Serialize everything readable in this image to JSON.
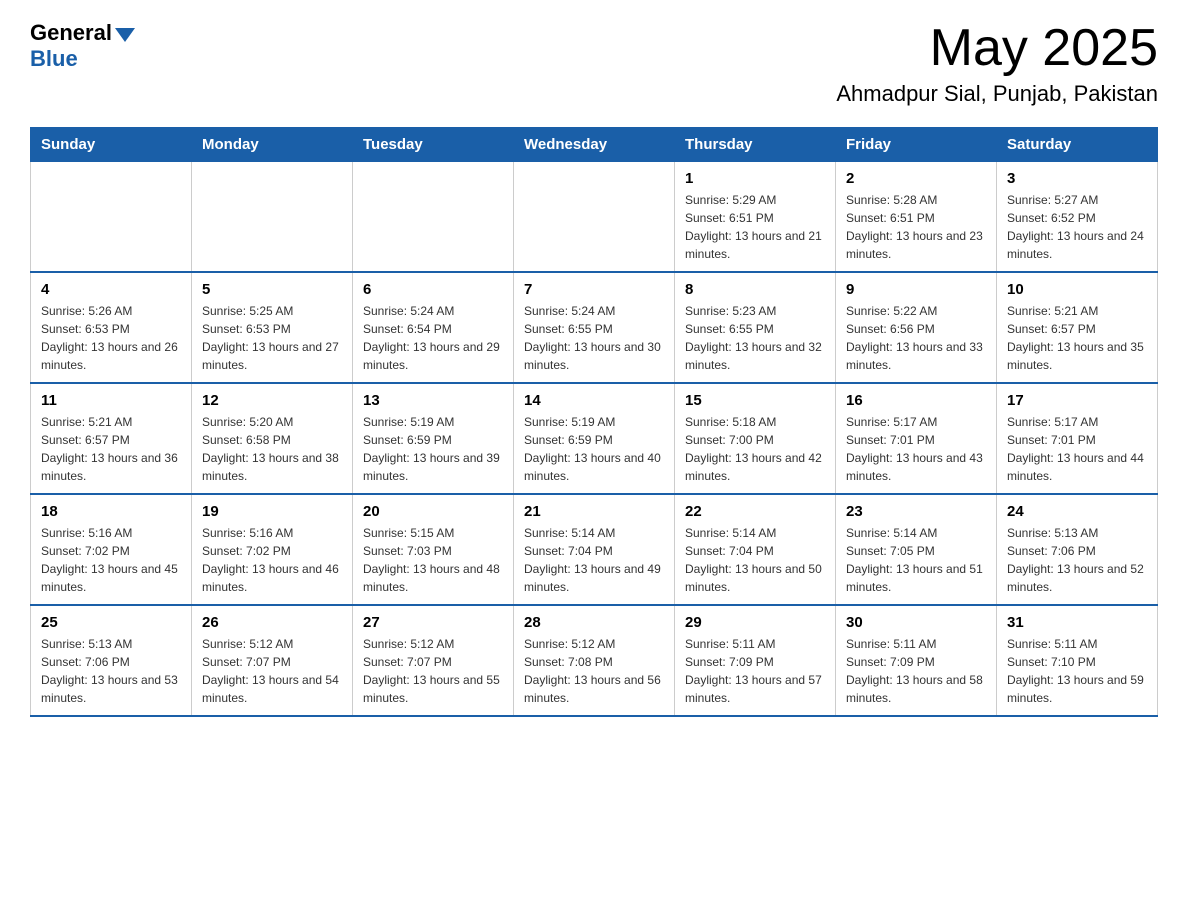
{
  "logo": {
    "general_text": "General",
    "blue_text": "Blue"
  },
  "title": {
    "month_year": "May 2025",
    "location": "Ahmadpur Sial, Punjab, Pakistan"
  },
  "weekdays": [
    "Sunday",
    "Monday",
    "Tuesday",
    "Wednesday",
    "Thursday",
    "Friday",
    "Saturday"
  ],
  "weeks": [
    [
      {
        "day": "",
        "info": ""
      },
      {
        "day": "",
        "info": ""
      },
      {
        "day": "",
        "info": ""
      },
      {
        "day": "",
        "info": ""
      },
      {
        "day": "1",
        "info": "Sunrise: 5:29 AM\nSunset: 6:51 PM\nDaylight: 13 hours and 21 minutes."
      },
      {
        "day": "2",
        "info": "Sunrise: 5:28 AM\nSunset: 6:51 PM\nDaylight: 13 hours and 23 minutes."
      },
      {
        "day": "3",
        "info": "Sunrise: 5:27 AM\nSunset: 6:52 PM\nDaylight: 13 hours and 24 minutes."
      }
    ],
    [
      {
        "day": "4",
        "info": "Sunrise: 5:26 AM\nSunset: 6:53 PM\nDaylight: 13 hours and 26 minutes."
      },
      {
        "day": "5",
        "info": "Sunrise: 5:25 AM\nSunset: 6:53 PM\nDaylight: 13 hours and 27 minutes."
      },
      {
        "day": "6",
        "info": "Sunrise: 5:24 AM\nSunset: 6:54 PM\nDaylight: 13 hours and 29 minutes."
      },
      {
        "day": "7",
        "info": "Sunrise: 5:24 AM\nSunset: 6:55 PM\nDaylight: 13 hours and 30 minutes."
      },
      {
        "day": "8",
        "info": "Sunrise: 5:23 AM\nSunset: 6:55 PM\nDaylight: 13 hours and 32 minutes."
      },
      {
        "day": "9",
        "info": "Sunrise: 5:22 AM\nSunset: 6:56 PM\nDaylight: 13 hours and 33 minutes."
      },
      {
        "day": "10",
        "info": "Sunrise: 5:21 AM\nSunset: 6:57 PM\nDaylight: 13 hours and 35 minutes."
      }
    ],
    [
      {
        "day": "11",
        "info": "Sunrise: 5:21 AM\nSunset: 6:57 PM\nDaylight: 13 hours and 36 minutes."
      },
      {
        "day": "12",
        "info": "Sunrise: 5:20 AM\nSunset: 6:58 PM\nDaylight: 13 hours and 38 minutes."
      },
      {
        "day": "13",
        "info": "Sunrise: 5:19 AM\nSunset: 6:59 PM\nDaylight: 13 hours and 39 minutes."
      },
      {
        "day": "14",
        "info": "Sunrise: 5:19 AM\nSunset: 6:59 PM\nDaylight: 13 hours and 40 minutes."
      },
      {
        "day": "15",
        "info": "Sunrise: 5:18 AM\nSunset: 7:00 PM\nDaylight: 13 hours and 42 minutes."
      },
      {
        "day": "16",
        "info": "Sunrise: 5:17 AM\nSunset: 7:01 PM\nDaylight: 13 hours and 43 minutes."
      },
      {
        "day": "17",
        "info": "Sunrise: 5:17 AM\nSunset: 7:01 PM\nDaylight: 13 hours and 44 minutes."
      }
    ],
    [
      {
        "day": "18",
        "info": "Sunrise: 5:16 AM\nSunset: 7:02 PM\nDaylight: 13 hours and 45 minutes."
      },
      {
        "day": "19",
        "info": "Sunrise: 5:16 AM\nSunset: 7:02 PM\nDaylight: 13 hours and 46 minutes."
      },
      {
        "day": "20",
        "info": "Sunrise: 5:15 AM\nSunset: 7:03 PM\nDaylight: 13 hours and 48 minutes."
      },
      {
        "day": "21",
        "info": "Sunrise: 5:14 AM\nSunset: 7:04 PM\nDaylight: 13 hours and 49 minutes."
      },
      {
        "day": "22",
        "info": "Sunrise: 5:14 AM\nSunset: 7:04 PM\nDaylight: 13 hours and 50 minutes."
      },
      {
        "day": "23",
        "info": "Sunrise: 5:14 AM\nSunset: 7:05 PM\nDaylight: 13 hours and 51 minutes."
      },
      {
        "day": "24",
        "info": "Sunrise: 5:13 AM\nSunset: 7:06 PM\nDaylight: 13 hours and 52 minutes."
      }
    ],
    [
      {
        "day": "25",
        "info": "Sunrise: 5:13 AM\nSunset: 7:06 PM\nDaylight: 13 hours and 53 minutes."
      },
      {
        "day": "26",
        "info": "Sunrise: 5:12 AM\nSunset: 7:07 PM\nDaylight: 13 hours and 54 minutes."
      },
      {
        "day": "27",
        "info": "Sunrise: 5:12 AM\nSunset: 7:07 PM\nDaylight: 13 hours and 55 minutes."
      },
      {
        "day": "28",
        "info": "Sunrise: 5:12 AM\nSunset: 7:08 PM\nDaylight: 13 hours and 56 minutes."
      },
      {
        "day": "29",
        "info": "Sunrise: 5:11 AM\nSunset: 7:09 PM\nDaylight: 13 hours and 57 minutes."
      },
      {
        "day": "30",
        "info": "Sunrise: 5:11 AM\nSunset: 7:09 PM\nDaylight: 13 hours and 58 minutes."
      },
      {
        "day": "31",
        "info": "Sunrise: 5:11 AM\nSunset: 7:10 PM\nDaylight: 13 hours and 59 minutes."
      }
    ]
  ]
}
